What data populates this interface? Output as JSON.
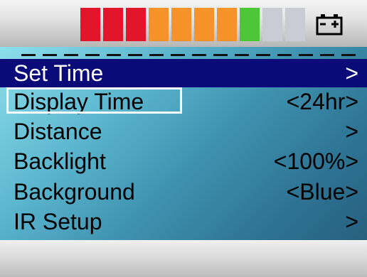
{
  "battery": {
    "segments": [
      "#e3152b",
      "#e3152b",
      "#e3152b",
      "#f5922a",
      "#f5922a",
      "#f5922a",
      "#f5922a",
      "#4dc638",
      "#c9cdd3",
      "#c9cdd3"
    ],
    "icon": "battery-icon"
  },
  "menu": {
    "items": [
      {
        "label": "Set Time",
        "value": ">",
        "selected": true
      },
      {
        "label": "Display Time",
        "value": "<24hr>",
        "selected": false
      },
      {
        "label": "Distance",
        "value": ">",
        "selected": false
      },
      {
        "label": "Backlight",
        "value": "<100%>",
        "selected": false
      },
      {
        "label": "Background",
        "value": "<Blue>",
        "selected": false
      },
      {
        "label": "IR Setup",
        "value": ">",
        "selected": false
      }
    ]
  },
  "colors": {
    "selected_bg": "#0a0a78",
    "highlight_border": "#ffffff"
  }
}
